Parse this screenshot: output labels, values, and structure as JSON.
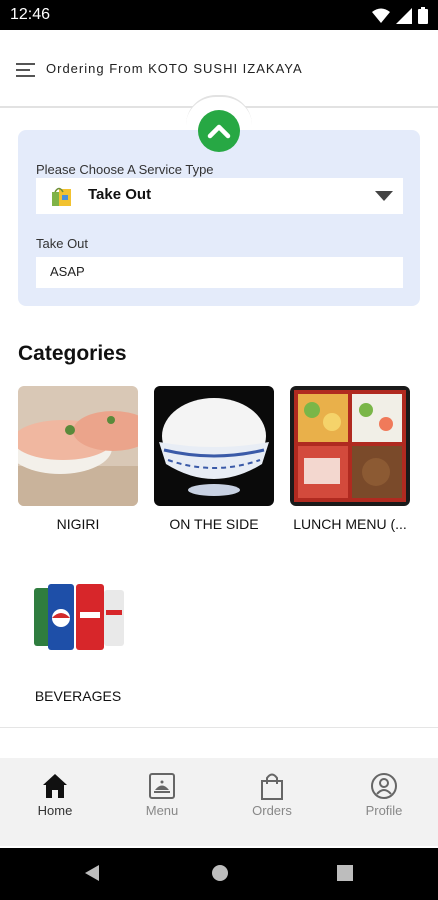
{
  "status_bar": {
    "time": "12:46"
  },
  "header": {
    "title": "Ordering From KOTO SUSHI IZAKAYA"
  },
  "service": {
    "type_label": "Please Choose A Service Type",
    "type_value": "Take Out",
    "time_label": "Take Out",
    "time_value": "ASAP"
  },
  "categories": {
    "heading": "Categories",
    "items": [
      {
        "label": "NIGIRI"
      },
      {
        "label": "ON THE SIDE"
      },
      {
        "label": "LUNCH MENU (..."
      },
      {
        "label": "BEVERAGES"
      }
    ]
  },
  "bottom_nav": {
    "items": [
      {
        "label": "Home",
        "icon": "home-icon"
      },
      {
        "label": "Menu",
        "icon": "menu-icon"
      },
      {
        "label": "Orders",
        "icon": "shopping-bag-icon"
      },
      {
        "label": "Profile",
        "icon": "profile-icon"
      }
    ]
  },
  "colors": {
    "accent_green": "#27a844",
    "panel_bg": "#e4ebfa",
    "nav_bg": "#f2f2f2"
  }
}
